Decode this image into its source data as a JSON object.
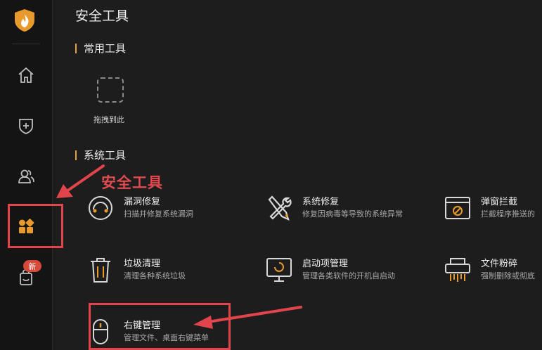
{
  "sidebar": {
    "badge": "新",
    "items": [
      {
        "name": "home",
        "icon": "home-icon"
      },
      {
        "name": "protection",
        "icon": "shield-plus-icon"
      },
      {
        "name": "users",
        "icon": "users-icon"
      },
      {
        "name": "security-tools",
        "icon": "tools-grid-icon",
        "active": true
      },
      {
        "name": "store",
        "icon": "bag-icon"
      }
    ]
  },
  "page": {
    "title": "安全工具"
  },
  "common_tools": {
    "heading": "常用工具",
    "drop_label": "拖拽到此"
  },
  "system_tools": {
    "heading": "系统工具",
    "items": [
      {
        "name": "漏洞修复",
        "desc": "扫描并修复系统漏洞",
        "icon": "gauge-icon"
      },
      {
        "name": "系统修复",
        "desc": "修复因病毒等导致的系统异常",
        "icon": "wrench-screwdriver-icon"
      },
      {
        "name": "弹窗拦截",
        "desc": "拦截程序推送的",
        "icon": "popup-block-icon"
      },
      {
        "name": "垃圾清理",
        "desc": "清理各种系统垃圾",
        "icon": "trash-icon"
      },
      {
        "name": "启动项管理",
        "desc": "管理各类软件的开机自启动",
        "icon": "monitor-startup-icon"
      },
      {
        "name": "文件粉碎",
        "desc": "强制删除或彻底",
        "icon": "shredder-icon"
      },
      {
        "name": "右键管理",
        "desc": "管理文件、桌面右键菜单",
        "icon": "mouse-icon"
      }
    ]
  },
  "annotation": {
    "label": "安全工具"
  },
  "colors": {
    "accent": "#e8a13a",
    "annotation_red": "#e1454b",
    "background": "#1d1d1d",
    "sidebar": "#141414"
  }
}
